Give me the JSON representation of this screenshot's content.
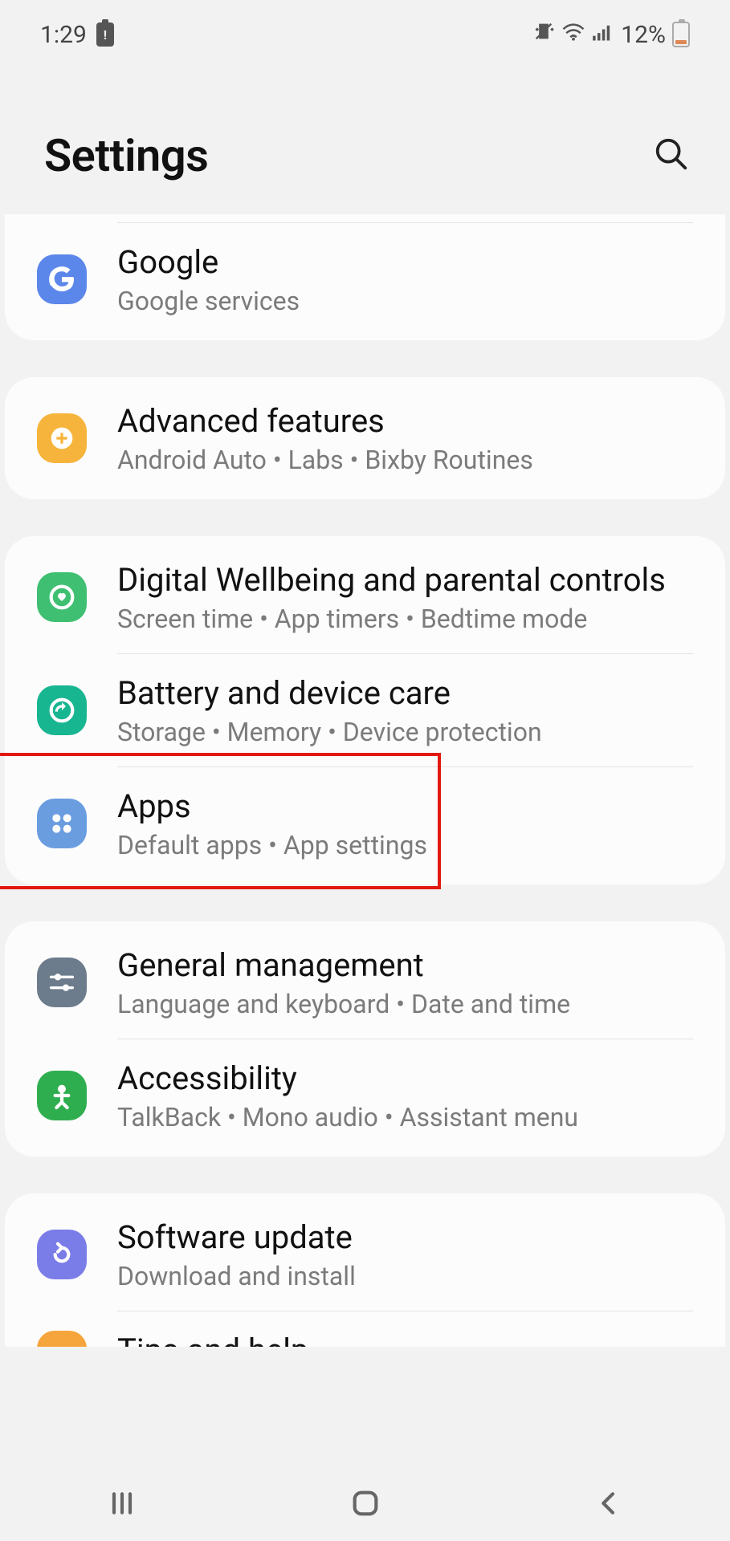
{
  "status": {
    "time": "1:29",
    "battery_percent": "12%"
  },
  "header": {
    "title": "Settings"
  },
  "groups": [
    {
      "items": [
        {
          "id": "google",
          "title": "Google",
          "subtitle": "Google services",
          "color": "#5c87ea",
          "icon": "google"
        }
      ],
      "first": true
    },
    {
      "items": [
        {
          "id": "advanced",
          "title": "Advanced features",
          "subtitle": "Android Auto  •  Labs  •  Bixby Routines",
          "color": "#f6b43c",
          "icon": "plus-cog"
        }
      ]
    },
    {
      "items": [
        {
          "id": "wellbeing",
          "title": "Digital Wellbeing and parental controls",
          "subtitle": "Screen time  •  App timers  •  Bedtime mode",
          "color": "#3fbf72",
          "icon": "heart-ring"
        },
        {
          "id": "battery",
          "title": "Battery and device care",
          "subtitle": "Storage  •  Memory  •  Device protection",
          "color": "#18b591",
          "icon": "refresh-ring"
        },
        {
          "id": "apps",
          "title": "Apps",
          "subtitle": "Default apps  •  App settings",
          "color": "#6a9de0",
          "icon": "four-dots",
          "highlighted": true
        }
      ]
    },
    {
      "items": [
        {
          "id": "general",
          "title": "General management",
          "subtitle": "Language and keyboard  •  Date and time",
          "color": "#6c7c8c",
          "icon": "sliders"
        },
        {
          "id": "accessibility",
          "title": "Accessibility",
          "subtitle": "TalkBack  •  Mono audio  •  Assistant menu",
          "color": "#2fae4f",
          "icon": "person"
        }
      ]
    },
    {
      "items": [
        {
          "id": "update",
          "title": "Software update",
          "subtitle": "Download and install",
          "color": "#7a7de8",
          "icon": "reload"
        },
        {
          "id": "tips",
          "title": "Tips and help",
          "subtitle": "",
          "color": "#f6a53c",
          "icon": "",
          "partial": true
        }
      ],
      "last": true
    }
  ]
}
